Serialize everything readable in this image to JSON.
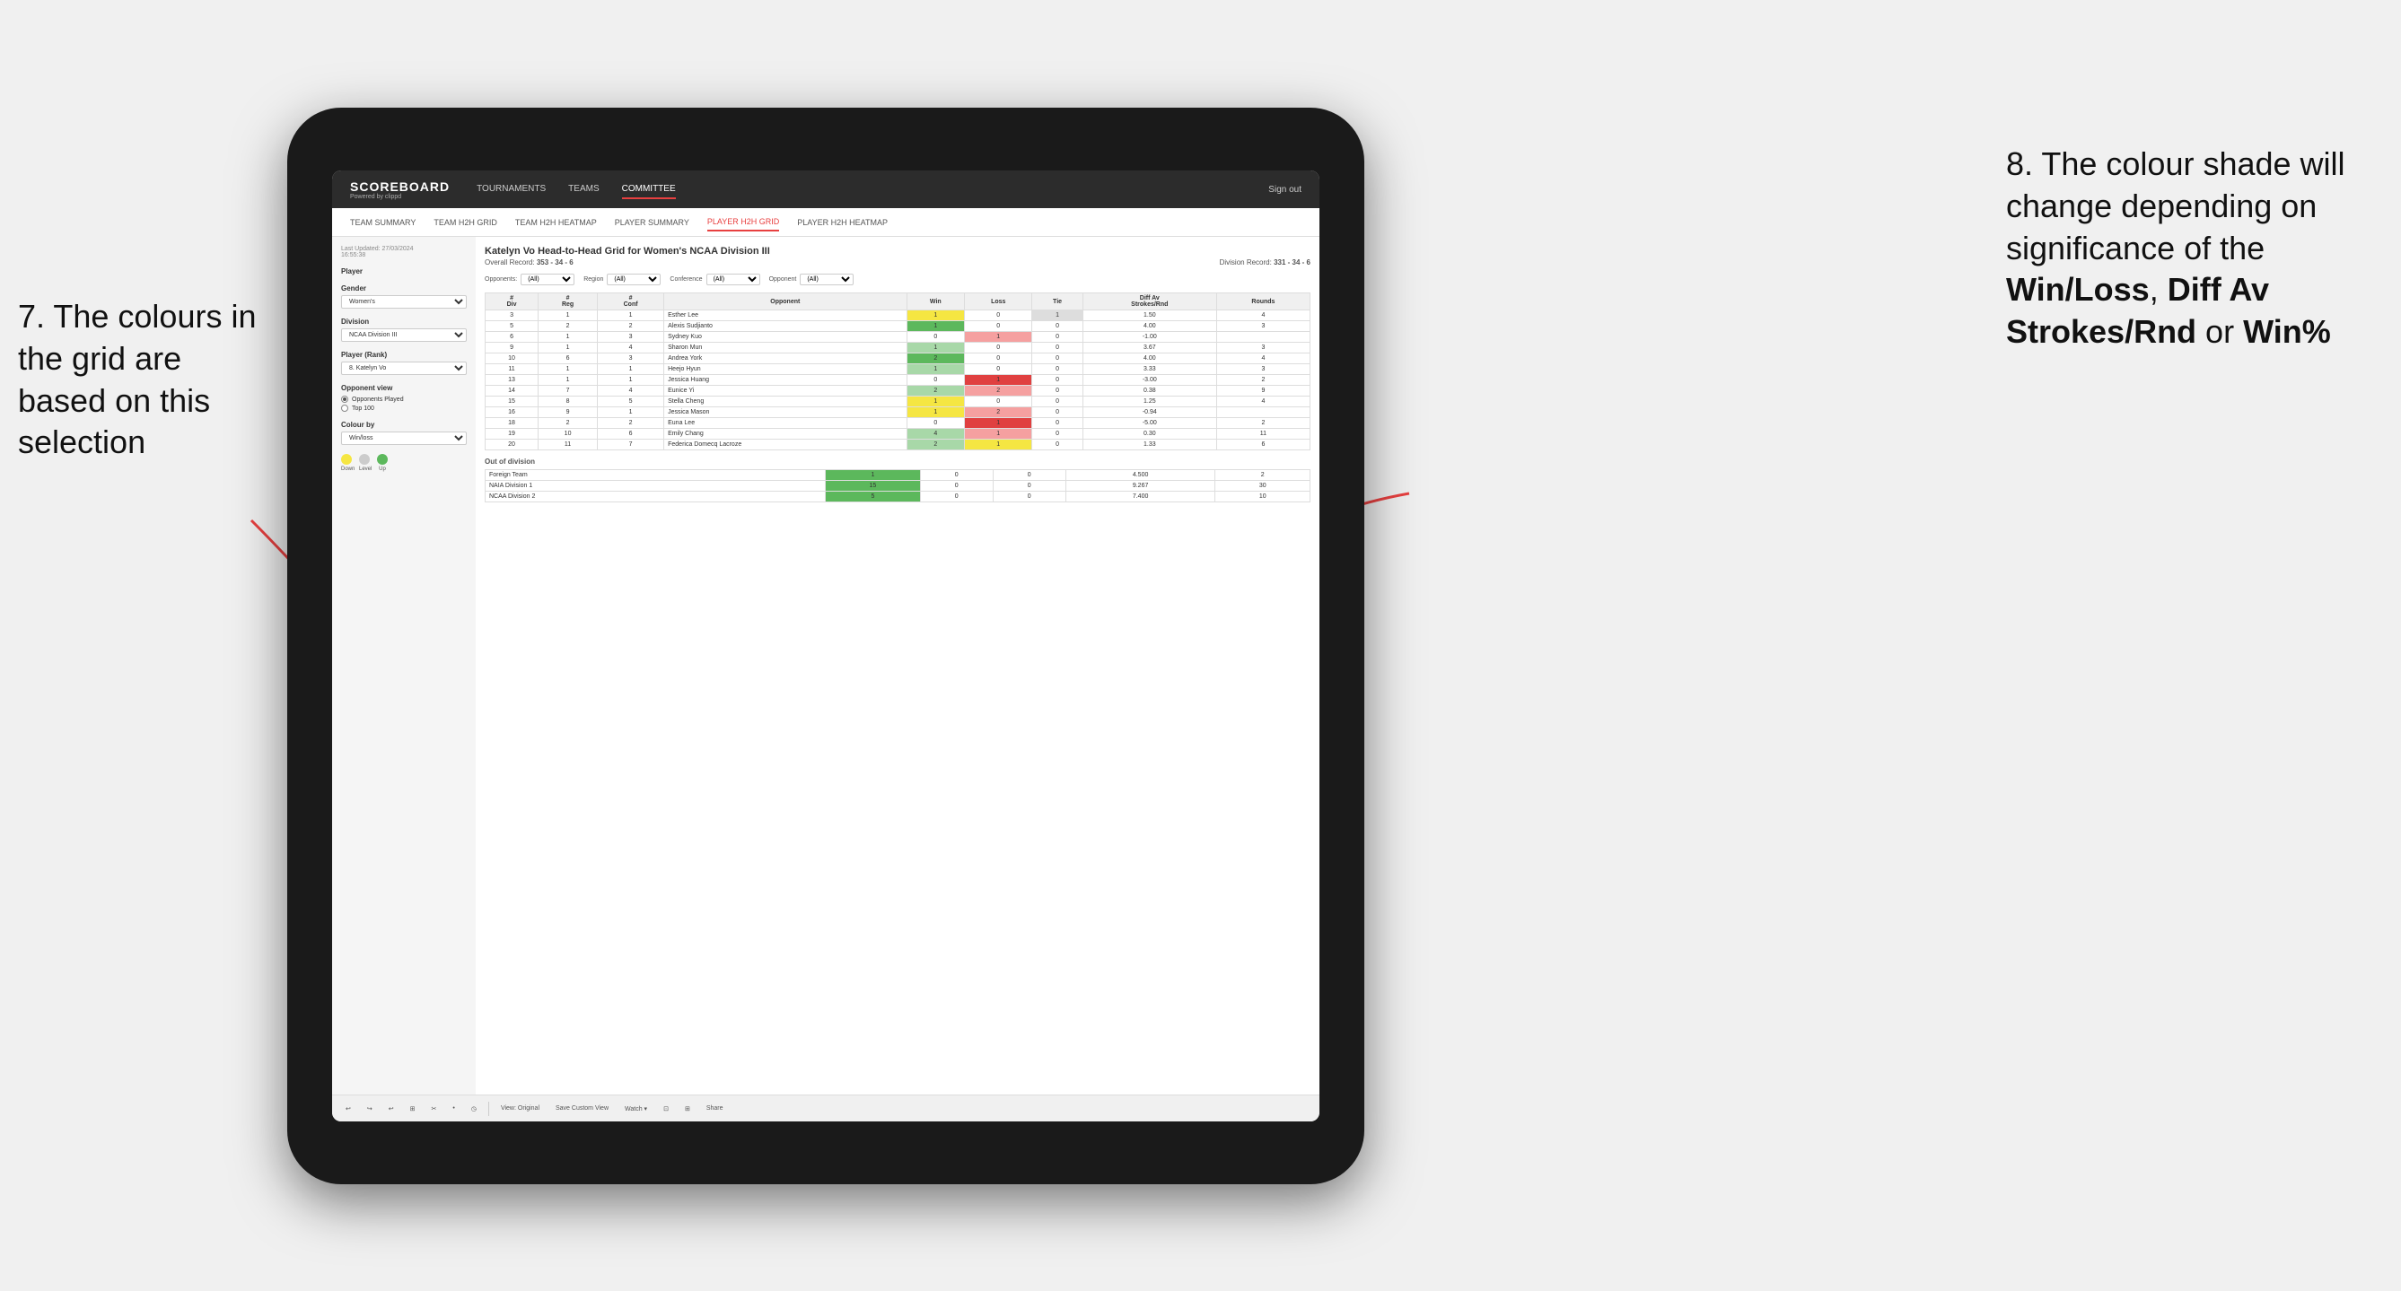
{
  "annotations": {
    "left": "7. The colours in the grid are based on this selection",
    "right_prefix": "8. The colour shade will change depending on significance of the ",
    "right_bold1": "Win/Loss",
    "right_sep1": ", ",
    "right_bold2": "Diff Av Strokes/Rnd",
    "right_sep2": " or ",
    "right_bold3": "Win%"
  },
  "nav": {
    "logo": "SCOREBOARD",
    "logo_sub": "Powered by clippd",
    "links": [
      "TOURNAMENTS",
      "TEAMS",
      "COMMITTEE"
    ],
    "active_link": "COMMITTEE",
    "sign_out": "Sign out"
  },
  "sub_nav": {
    "links": [
      "TEAM SUMMARY",
      "TEAM H2H GRID",
      "TEAM H2H HEATMAP",
      "PLAYER SUMMARY",
      "PLAYER H2H GRID",
      "PLAYER H2H HEATMAP"
    ],
    "active": "PLAYER H2H GRID"
  },
  "sidebar": {
    "last_updated": "Last Updated: 27/03/2024\n16:55:38",
    "player_label": "Player",
    "gender_label": "Gender",
    "gender_value": "Women's",
    "division_label": "Division",
    "division_value": "NCAA Division III",
    "player_rank_label": "Player (Rank)",
    "player_rank_value": "8. Katelyn Vo",
    "opponent_view_label": "Opponent view",
    "radio_options": [
      "Opponents Played",
      "Top 100"
    ],
    "radio_selected": "Opponents Played",
    "colour_by_label": "Colour by",
    "colour_by_value": "Win/loss",
    "colours": [
      {
        "color": "#f5e642",
        "label": "Down"
      },
      {
        "color": "#cccccc",
        "label": "Level"
      },
      {
        "color": "#5cb85c",
        "label": "Up"
      }
    ]
  },
  "grid": {
    "title": "Katelyn Vo Head-to-Head Grid for Women's NCAA Division III",
    "overall_record_label": "Overall Record:",
    "overall_record": "353 - 34 - 6",
    "division_record_label": "Division Record:",
    "division_record": "331 - 34 - 6",
    "filter_opponents_label": "Opponents:",
    "filter_region_label": "Region",
    "filter_conference_label": "Conference",
    "filter_opponent_label": "Opponent",
    "filter_all": "(All)",
    "col_headers": [
      "#\nDiv",
      "#\nReg",
      "#\nConf",
      "Opponent",
      "Win",
      "Loss",
      "Tie",
      "Diff Av\nStrokes/Rnd",
      "Rounds"
    ],
    "rows": [
      {
        "div": 3,
        "reg": 1,
        "conf": 1,
        "name": "Esther Lee",
        "win": 1,
        "loss": 0,
        "tie": 1,
        "diff": 1.5,
        "rounds": 4,
        "win_color": "yellow",
        "loss_color": "",
        "tie_color": "gray"
      },
      {
        "div": 5,
        "reg": 2,
        "conf": 2,
        "name": "Alexis Sudjianto",
        "win": 1,
        "loss": 0,
        "tie": 0,
        "diff": 4.0,
        "rounds": 3,
        "win_color": "green-dark",
        "loss_color": "",
        "tie_color": ""
      },
      {
        "div": 6,
        "reg": 1,
        "conf": 3,
        "name": "Sydney Kuo",
        "win": 0,
        "loss": 1,
        "tie": 0,
        "diff": -1.0,
        "rounds": "",
        "win_color": "",
        "loss_color": "red-light",
        "tie_color": ""
      },
      {
        "div": 9,
        "reg": 1,
        "conf": 4,
        "name": "Sharon Mun",
        "win": 1,
        "loss": 0,
        "tie": 0,
        "diff": 3.67,
        "rounds": 3,
        "win_color": "green-light",
        "loss_color": "",
        "tie_color": ""
      },
      {
        "div": 10,
        "reg": 6,
        "conf": 3,
        "name": "Andrea York",
        "win": 2,
        "loss": 0,
        "tie": 0,
        "diff": 4.0,
        "rounds": 4,
        "win_color": "green-dark",
        "loss_color": "",
        "tie_color": ""
      },
      {
        "div": 11,
        "reg": 1,
        "conf": 1,
        "name": "Heejo Hyun",
        "win": 1,
        "loss": 0,
        "tie": 0,
        "diff": 3.33,
        "rounds": 3,
        "win_color": "green-light",
        "loss_color": "",
        "tie_color": ""
      },
      {
        "div": 13,
        "reg": 1,
        "conf": 1,
        "name": "Jessica Huang",
        "win": 0,
        "loss": 1,
        "tie": 0,
        "diff": -3.0,
        "rounds": 2,
        "win_color": "",
        "loss_color": "red-dark",
        "tie_color": ""
      },
      {
        "div": 14,
        "reg": 7,
        "conf": 4,
        "name": "Eunice Yi",
        "win": 2,
        "loss": 2,
        "tie": 0,
        "diff": 0.38,
        "rounds": 9,
        "win_color": "green-light",
        "loss_color": "red-light",
        "tie_color": ""
      },
      {
        "div": 15,
        "reg": 8,
        "conf": 5,
        "name": "Stella Cheng",
        "win": 1,
        "loss": 0,
        "tie": 0,
        "diff": 1.25,
        "rounds": 4,
        "win_color": "yellow",
        "loss_color": "",
        "tie_color": ""
      },
      {
        "div": 16,
        "reg": 9,
        "conf": 1,
        "name": "Jessica Mason",
        "win": 1,
        "loss": 2,
        "tie": 0,
        "diff": -0.94,
        "rounds": "",
        "win_color": "yellow",
        "loss_color": "red-light",
        "tie_color": ""
      },
      {
        "div": 18,
        "reg": 2,
        "conf": 2,
        "name": "Euna Lee",
        "win": 0,
        "loss": 1,
        "tie": 0,
        "diff": -5.0,
        "rounds": 2,
        "win_color": "",
        "loss_color": "red-dark",
        "tie_color": ""
      },
      {
        "div": 19,
        "reg": 10,
        "conf": 6,
        "name": "Emily Chang",
        "win": 4,
        "loss": 1,
        "tie": 0,
        "diff": 0.3,
        "rounds": 11,
        "win_color": "green-light",
        "loss_color": "red-light",
        "tie_color": ""
      },
      {
        "div": 20,
        "reg": 11,
        "conf": 7,
        "name": "Federica Domecq Lacroze",
        "win": 2,
        "loss": 1,
        "tie": 0,
        "diff": 1.33,
        "rounds": 6,
        "win_color": "green-light",
        "loss_color": "yellow",
        "tie_color": ""
      }
    ],
    "out_of_division_label": "Out of division",
    "out_of_division_rows": [
      {
        "name": "Foreign Team",
        "win": 1,
        "loss": 0,
        "tie": 0,
        "diff": 4.5,
        "rounds": 2,
        "win_color": "green-dark"
      },
      {
        "name": "NAIA Division 1",
        "win": 15,
        "loss": 0,
        "tie": 0,
        "diff": 9.267,
        "rounds": 30,
        "win_color": "green-dark"
      },
      {
        "name": "NCAA Division 2",
        "win": 5,
        "loss": 0,
        "tie": 0,
        "diff": 7.4,
        "rounds": 10,
        "win_color": "green-dark"
      }
    ]
  },
  "toolbar": {
    "buttons": [
      "↩",
      "↪",
      "↩",
      "⊞",
      "✂",
      "·",
      "◷",
      "|",
      "View: Original",
      "Save Custom View",
      "Watch ▾",
      "⊡",
      "⊞",
      "Share"
    ]
  }
}
